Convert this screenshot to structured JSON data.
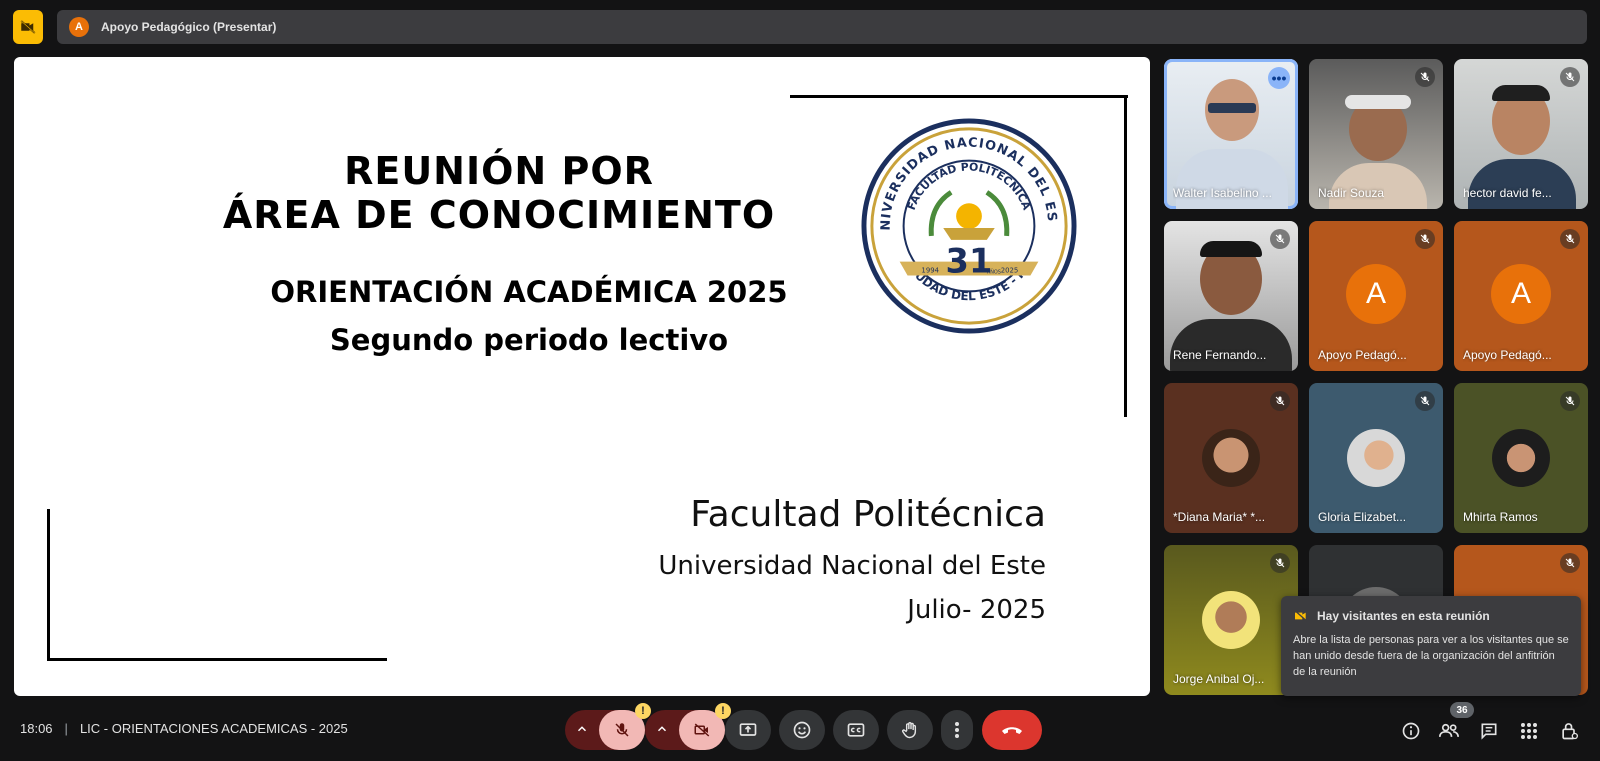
{
  "header": {
    "presenter_initial": "A",
    "presenter_label": "Apoyo Pedagógico (Presentar)"
  },
  "slide": {
    "title_line1": "REUNIÓN POR",
    "title_line2": "ÁREA DE CONOCIMIENTO",
    "subtitle_line1": "ORIENTACIÓN ACADÉMICA 2025",
    "subtitle_line2": "Segundo periodo lectivo",
    "faculty": "Facultad Politécnica",
    "university": "Universidad Nacional del Este",
    "date": "Julio- 2025",
    "seal": {
      "top_text": "UNIVERSIDAD NACIONAL DEL ESTE",
      "inner_text": "FACULTAD POLITÉCNICA",
      "bottom_text": "CIUDAD DEL ESTE - PY",
      "number": "31",
      "year_left": "1994",
      "year_right": "2025",
      "years_label": "AÑOS"
    }
  },
  "participants": [
    {
      "name": "Walter Isabelino ...",
      "kind": "video"
    },
    {
      "name": "Nadir Souza",
      "kind": "video"
    },
    {
      "name": "hector david fe...",
      "kind": "video"
    },
    {
      "name": "Rene Fernando...",
      "kind": "video"
    },
    {
      "name": "Apoyo Pedagó...",
      "kind": "avatar",
      "initial": "A"
    },
    {
      "name": "Apoyo Pedagó...",
      "kind": "avatar",
      "initial": "A"
    },
    {
      "name": "*Diana Maria* *...",
      "kind": "photo"
    },
    {
      "name": "Gloria Elizabet...",
      "kind": "photo"
    },
    {
      "name": "Mhirta Ramos",
      "kind": "photo"
    },
    {
      "name": "Jorge Anibal Oj...",
      "kind": "photo"
    }
  ],
  "notice": {
    "title": "Hay visitantes en esta reunión",
    "body": "Abre la lista de personas para ver a los visitantes que se han unido desde fuera de la organización del anfitrión de la reunión"
  },
  "footer": {
    "time": "18:06",
    "separator": "|",
    "meeting_name": "LIC - ORIENTACIONES ACADEMICAS - 2025",
    "people_count": "36",
    "warn_glyph": "!"
  },
  "colors": {
    "accent_orange": "#e8710a",
    "warning_yellow": "#fbbc04",
    "hangup_red": "#dc362e",
    "muted_red": "#f2b8b5",
    "slide_bg": "#ffffff",
    "bg": "#131314"
  },
  "icons": [
    "camera-off-icon",
    "mic-off-icon",
    "more-icon",
    "present-icon",
    "emoji-icon",
    "captions-icon",
    "raise-hand-icon",
    "more-vert-icon",
    "hangup-icon",
    "info-icon",
    "people-icon",
    "chat-icon",
    "activities-icon",
    "host-controls-icon",
    "chevron-up-icon"
  ]
}
